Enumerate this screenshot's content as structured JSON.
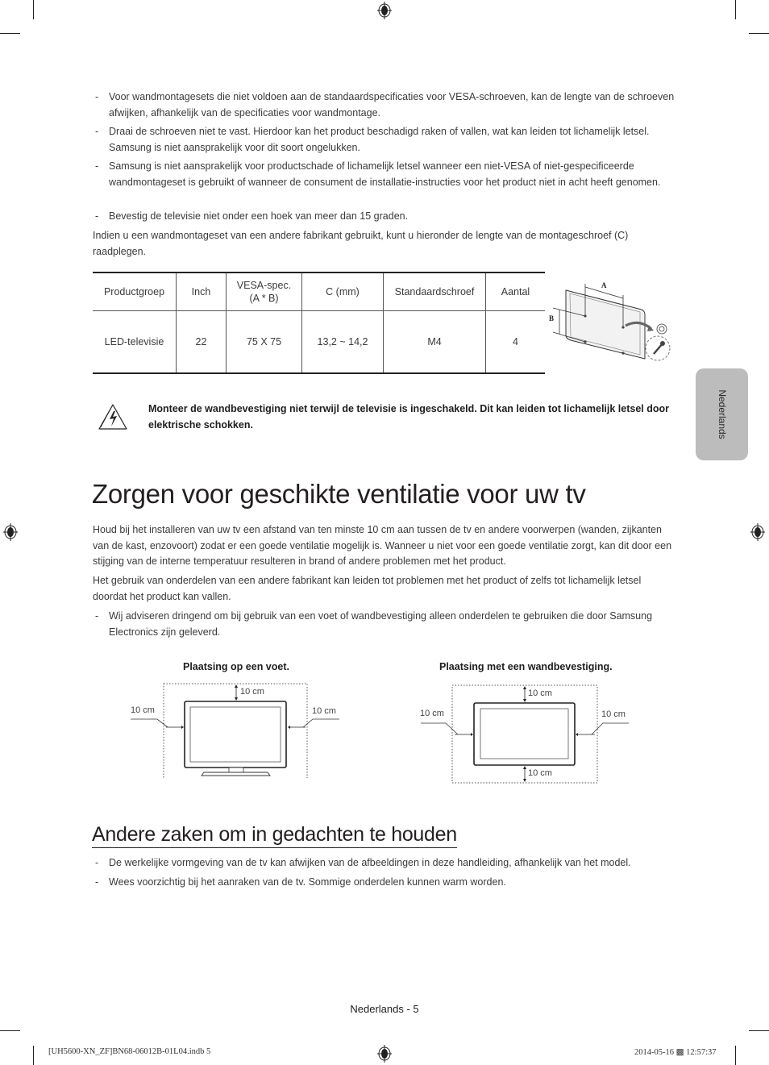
{
  "top_bullets": [
    "Voor wandmontagesets die niet voldoen aan de standaardspecificaties voor VESA-schroeven, kan de lengte van de schroeven afwijken, afhankelijk van de specificaties voor wandmontage.",
    "Draai de schroeven niet te vast. Hierdoor kan het product beschadigd raken of vallen, wat kan leiden tot lichamelijk letsel. Samsung is niet aansprakelijk voor dit soort ongelukken.",
    "Samsung is niet aansprakelijk voor productschade of lichamelijk letsel wanneer een niet-VESA of niet-gespecificeerde wandmontageset is gebruikt of wanneer de consument de installatie-instructies voor het product niet in acht heeft genomen.",
    "Bevestig de televisie niet onder een hoek van meer dan 15 graden."
  ],
  "bullet_dash": "-",
  "intro_paragraph": "Indien u een wandmontageset van een andere fabrikant gebruikt, kunt u hieronder de lengte van de montageschroef (C) raadplegen.",
  "spec_table": {
    "headers": [
      "Productgroep",
      "Inch",
      "VESA-spec.\n(A * B)",
      "C (mm)",
      "Standaardschroef",
      "Aantal"
    ],
    "rows": [
      [
        "LED-televisie",
        "22",
        "75 X 75",
        "13,2 ~ 14,2",
        "M4",
        "4"
      ]
    ]
  },
  "wall_diagram": {
    "label_a": "A",
    "label_b": "B"
  },
  "warning": {
    "icon": "electric-shock-warning-icon",
    "text": "Monteer de wandbevestiging niet terwijl de televisie is ingeschakeld. Dit kan leiden tot lichamelijk letsel door elektrische schokken."
  },
  "ventilation": {
    "title": "Zorgen voor geschikte ventilatie voor uw tv",
    "paragraphs": [
      "Houd bij het installeren van uw tv een afstand van ten minste 10 cm aan tussen de tv en andere voorwerpen (wanden, zijkanten van de kast, enzovoort) zodat er een goede ventilatie mogelijk is. Wanneer u niet voor een goede ventilatie zorgt, kan dit door een stijging van de interne temperatuur resulteren in brand of andere problemen met het product.",
      "Het gebruik van onderdelen van een andere fabrikant kan leiden tot problemen met het product of zelfs tot lichamelijk letsel doordat het product kan vallen."
    ],
    "bullets": [
      "Wij adviseren dringend om bij gebruik van een voet of wandbevestiging alleen onderdelen te gebruiken die door Samsung Electronics zijn geleverd."
    ],
    "diagrams": {
      "stand": {
        "title": "Plaatsing op een voet.",
        "top": "10 cm",
        "left": "10 cm",
        "right": "10 cm"
      },
      "wall": {
        "title": "Plaatsing met een wandbevestiging.",
        "top": "10 cm",
        "left": "10 cm",
        "right": "10 cm",
        "bottom": "10 cm"
      }
    }
  },
  "other": {
    "title": "Andere zaken om in gedachten te houden",
    "bullets": [
      "De werkelijke vormgeving van de tv kan afwijken van de afbeeldingen in deze handleiding, afhankelijk van het model.",
      "Wees voorzichtig bij het aanraken van de tv. Sommige onderdelen kunnen warm worden."
    ]
  },
  "side_tab": "Nederlands",
  "footer": {
    "page_label": "Nederlands - 5",
    "slug_left": "[UH5600-XN_ZF]BN68-06012B-01L04.indb   5",
    "slug_right": "2014-05-16   ▩ 12:57:37"
  }
}
